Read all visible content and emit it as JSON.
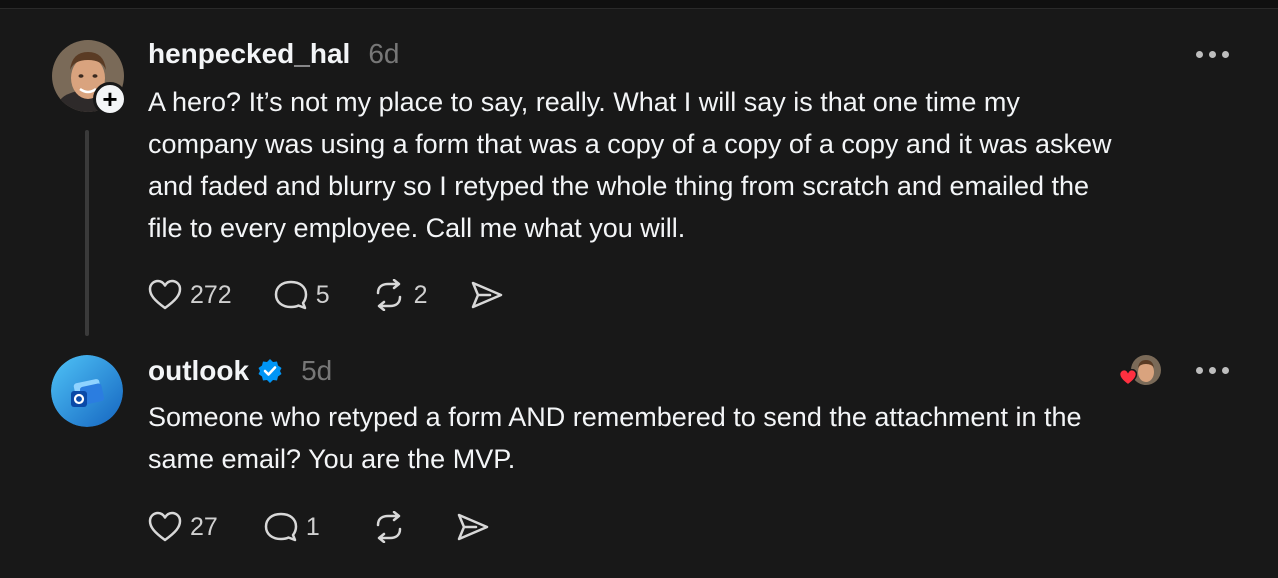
{
  "posts": [
    {
      "username": "henpecked_hal",
      "time": "6d",
      "text": "A hero? It’s not my place to say, really. What I will say is that one time my company was using a form that was a copy of a copy of a copy and it was askew and faded and blurry so I retyped the whole thing from scratch and emailed the file to every employee. Call me what you will.",
      "likes": "272",
      "replies": "5",
      "reposts": "2"
    },
    {
      "username": "outlook",
      "time": "5d",
      "text": "Someone who retyped a form AND remembered to send the attachment in the same email? You are the MVP.",
      "likes": "27",
      "replies": "1",
      "reposts": ""
    }
  ],
  "colors": {
    "background": "#181818",
    "text": "#f3f5f7",
    "muted": "#777777",
    "verified": "#0095f6",
    "heart": "#ff3040"
  },
  "icons": [
    "plus-icon",
    "heart-icon",
    "comment-icon",
    "repost-icon",
    "share-icon",
    "verified-icon",
    "more-icon"
  ]
}
